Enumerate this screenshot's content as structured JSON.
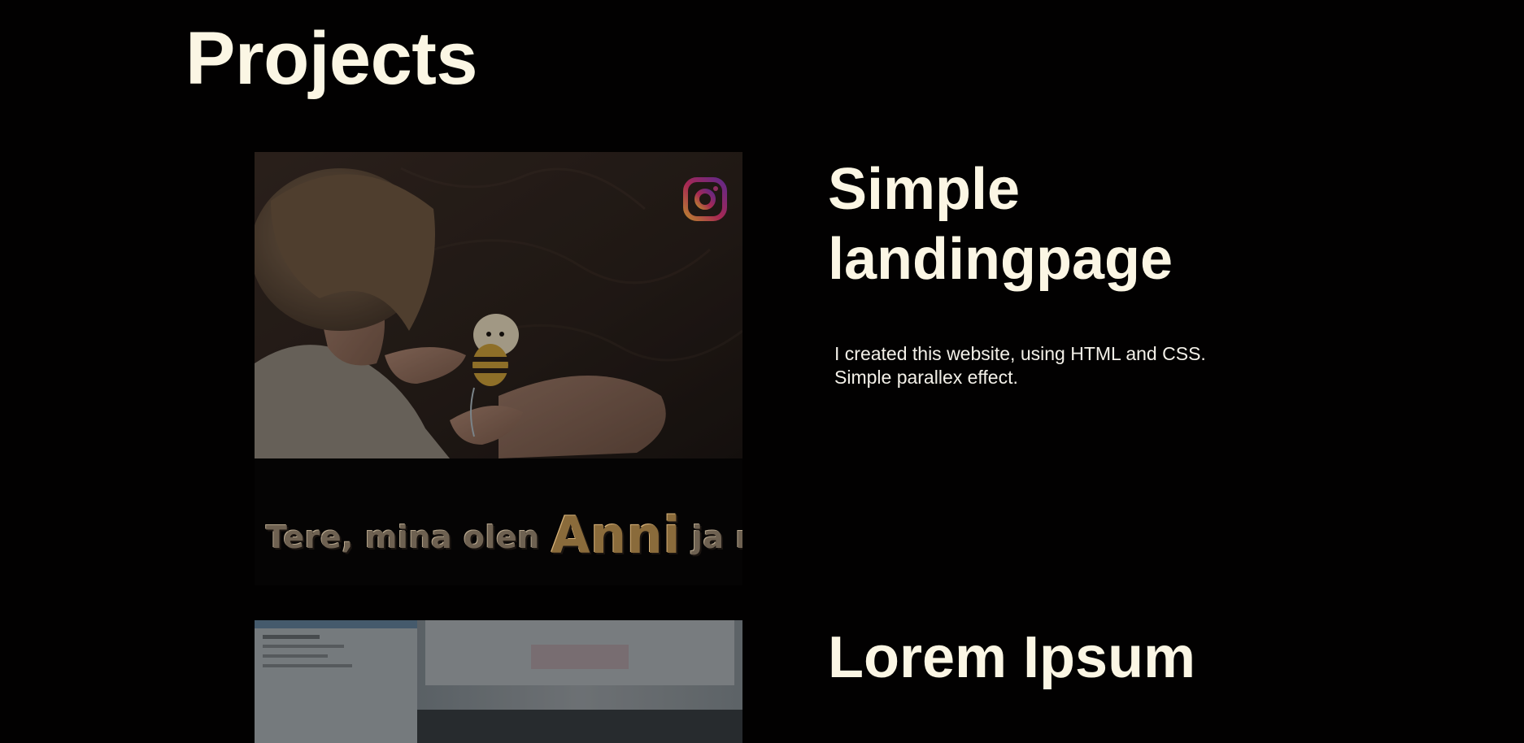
{
  "page": {
    "title": "Projects",
    "background": "#020101",
    "text_color": "#fbf6e4"
  },
  "projects": [
    {
      "title_line1": "Simple",
      "title_line2": "landingpage",
      "description_line1": "I created this website, using HTML and CSS.",
      "description_line2": "Simple parallex effect.",
      "thumbnail": {
        "caption_pre": "Tere, mina olen",
        "caption_name": "Anni",
        "caption_post": "ja ma",
        "icon": "instagram-icon"
      }
    },
    {
      "title": "Lorem Ipsum"
    }
  ]
}
